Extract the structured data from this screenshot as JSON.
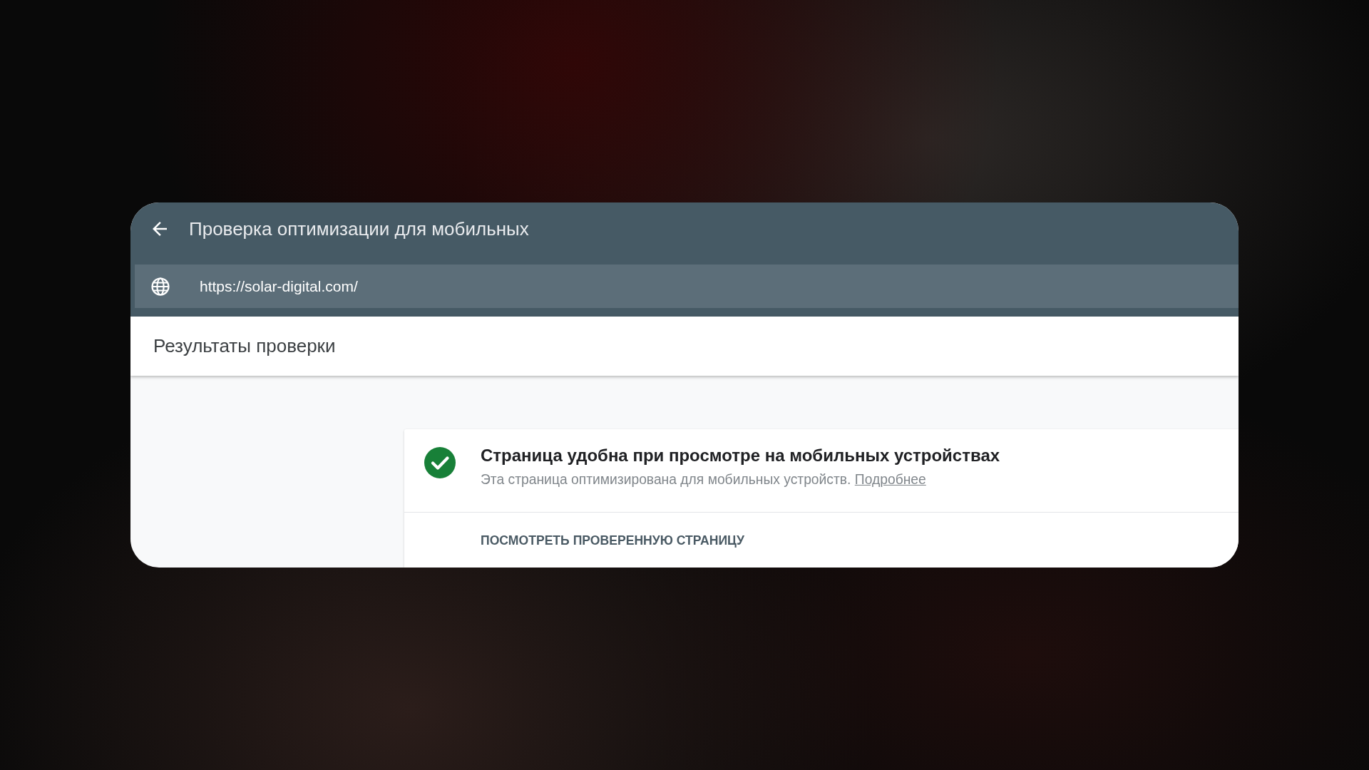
{
  "header": {
    "title": "Проверка оптимизации для мобильных"
  },
  "url_bar": {
    "value": "https://solar-digital.com/"
  },
  "results": {
    "title": "Результаты проверки"
  },
  "result_card": {
    "passed": true,
    "heading": "Страница удобна при просмотре на мобильных устройствах",
    "description": "Эта страница оптимизирована для мобильных устройств.",
    "link": "Подробнее",
    "action": "ПОСМОТРЕТЬ ПРОВЕРЕННУЮ СТРАНИЦУ"
  }
}
